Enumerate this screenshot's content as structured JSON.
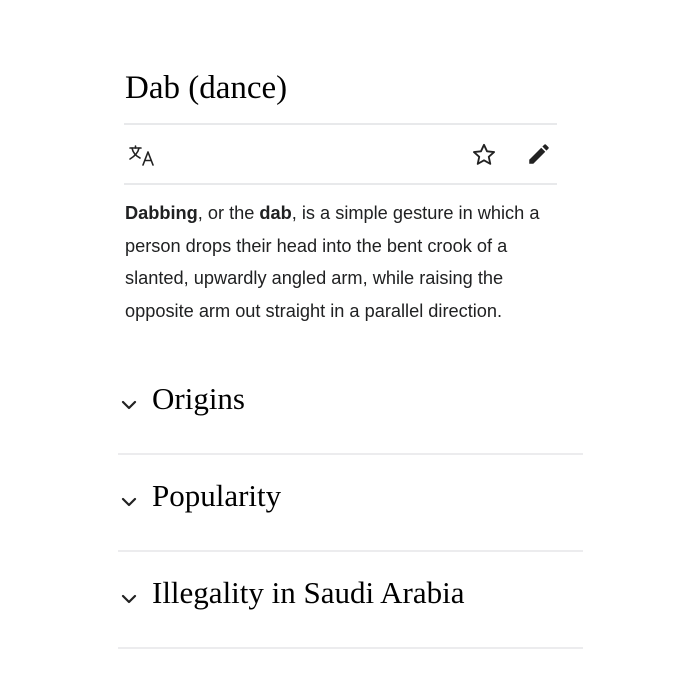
{
  "article": {
    "title": "Dab (dance)"
  },
  "toolbar": {
    "language_icon": "translate-icon",
    "watch_icon": "star-icon",
    "edit_icon": "pencil-icon"
  },
  "lead": {
    "term1": "Dabbing",
    "text1": ", or the ",
    "term2": "dab",
    "text2": ", is a simple gesture in which a person drops their head into the bent crook of a slanted, upwardly angled arm, while raising the opposite arm out straight in a parallel direction."
  },
  "sections": [
    {
      "label": "Origins",
      "icon": "chevron-down-icon"
    },
    {
      "label": "Popularity",
      "icon": "chevron-down-icon"
    },
    {
      "label": "Illegality in Saudi Arabia",
      "icon": "chevron-down-icon"
    }
  ]
}
